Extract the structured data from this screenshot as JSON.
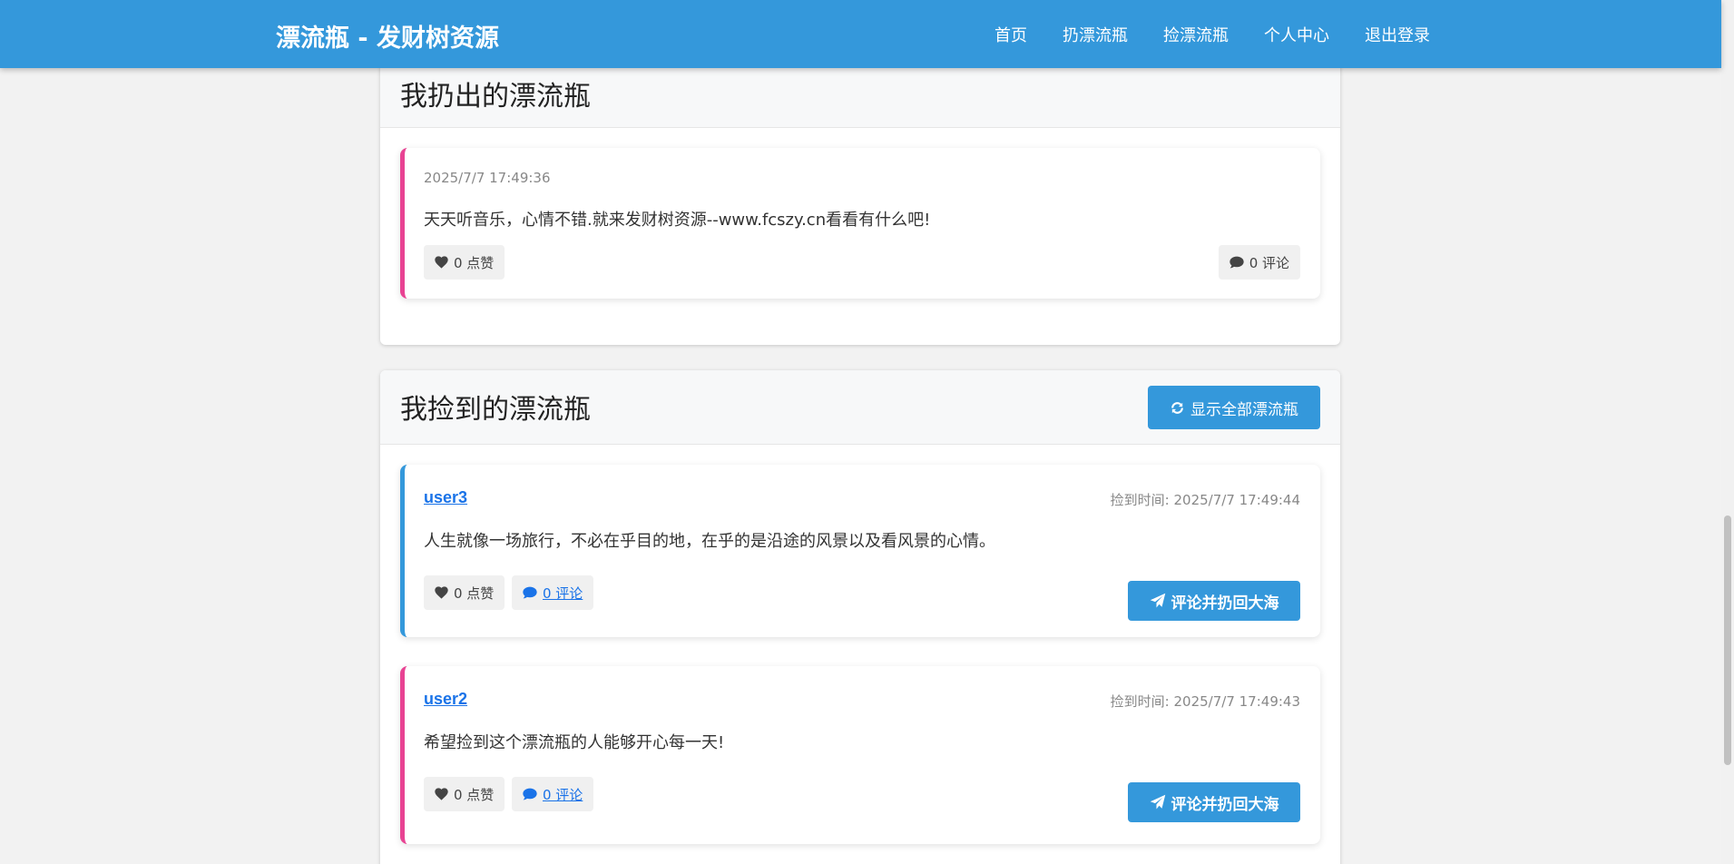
{
  "nav": {
    "brand": "漂流瓶 - 发财树资源",
    "links": [
      "首页",
      "扔漂流瓶",
      "捡漂流瓶",
      "个人中心",
      "退出登录"
    ]
  },
  "thrown": {
    "title": "我扔出的漂流瓶",
    "bottles": [
      {
        "time": "2025/7/7 17:49:36",
        "content": "天天听音乐，心情不错.就来发财树资源--www.fcszy.cn看看有什么吧!",
        "likes": "0 点赞",
        "comments": "0 评论"
      }
    ]
  },
  "picked": {
    "title": "我捡到的漂流瓶",
    "refresh_label": "显示全部漂流瓶",
    "bottles": [
      {
        "user": "user3",
        "time": "捡到时间: 2025/7/7 17:49:44",
        "content": "人生就像一场旅行，不必在乎目的地，在乎的是沿途的风景以及看风景的心情。",
        "likes": "0 点赞",
        "comments": "0 评论",
        "action": "评论并扔回大海"
      },
      {
        "user": "user2",
        "time": "捡到时间: 2025/7/7 17:49:43",
        "content": "希望捡到这个漂流瓶的人能够开心每一天!",
        "likes": "0 点赞",
        "comments": "0 评论",
        "action": "评论并扔回大海"
      }
    ]
  },
  "colors": {
    "primary": "#3498db",
    "accent_pink": "#e84393",
    "link": "#1a73e8"
  },
  "icons": {
    "like": "heart-icon",
    "comment": "comment-icon",
    "refresh": "refresh-icon",
    "send": "paper-plane-icon"
  }
}
